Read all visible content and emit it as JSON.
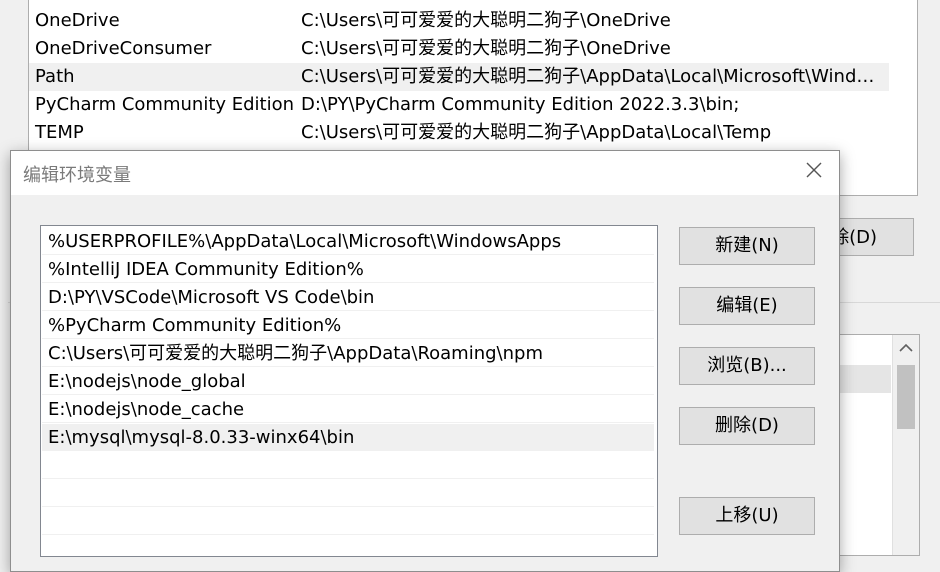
{
  "background_window": {
    "vars": [
      {
        "name": "",
        "value": ""
      },
      {
        "name": "OneDrive",
        "value": "C:\\Users\\可可爱爱的大聪明二狗子\\OneDrive"
      },
      {
        "name": "OneDriveConsumer",
        "value": "C:\\Users\\可可爱爱的大聪明二狗子\\OneDrive"
      },
      {
        "name": "Path",
        "value": "C:\\Users\\可可爱爱的大聪明二狗子\\AppData\\Local\\Microsoft\\Windo..."
      },
      {
        "name": "PyCharm Community Edition",
        "value": "D:\\PY\\PyCharm Community Edition 2022.3.3\\bin;"
      },
      {
        "name": "TEMP",
        "value": "C:\\Users\\可可爱爱的大聪明二狗子\\AppData\\Local\\Temp"
      }
    ],
    "delete_button_partial": "除(D)"
  },
  "dialog": {
    "title": "编辑环境变量",
    "paths": [
      "%USERPROFILE%\\AppData\\Local\\Microsoft\\WindowsApps",
      "%IntelliJ IDEA Community Edition%",
      "D:\\PY\\VSCode\\Microsoft VS Code\\bin",
      "%PyCharm Community Edition%",
      "C:\\Users\\可可爱爱的大聪明二狗子\\AppData\\Roaming\\npm",
      "E:\\nodejs\\node_global",
      "E:\\nodejs\\node_cache",
      "E:\\mysql\\mysql-8.0.33-winx64\\bin",
      "",
      "",
      ""
    ],
    "buttons": {
      "new": "新建(N)",
      "edit": "编辑(E)",
      "browse": "浏览(B)...",
      "delete": "删除(D)",
      "move_up": "上移(U)"
    }
  }
}
